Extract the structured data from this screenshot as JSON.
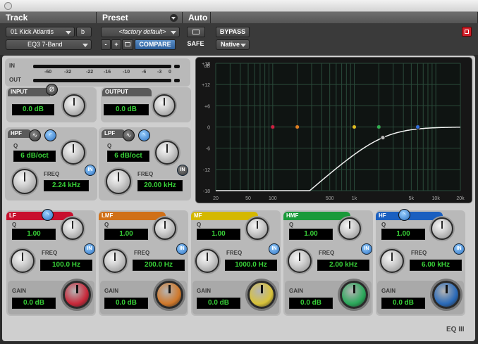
{
  "header": {
    "track_label": "Track",
    "preset_label": "Preset",
    "auto_label": "Auto",
    "track_name": "01 Kick Atlantis",
    "channel_select": "b",
    "insert_plugin": "EQ3 7-Band",
    "preset_name": "<factory default>",
    "minus_label": "-",
    "plus_label": "+",
    "compare_label": "COMPARE",
    "bypass_label": "BYPASS",
    "safe_label": "SAFE",
    "native_label": "Native"
  },
  "meters": {
    "in_label": "IN",
    "out_label": "OUT",
    "scale": [
      "-60",
      "-32",
      "-22",
      "-16",
      "-10",
      "-6",
      "-3",
      "0"
    ]
  },
  "input": {
    "label": "INPUT",
    "value": "0.0 dB"
  },
  "output": {
    "label": "OUTPUT",
    "value": "0.0 dB"
  },
  "hpf": {
    "label": "HPF",
    "q_label": "Q",
    "slope": "6 dB/oct",
    "freq_label": "FREQ",
    "freq": "2.24 kHz",
    "in_label": "IN"
  },
  "lpf": {
    "label": "LPF",
    "q_label": "Q",
    "slope": "6 dB/oct",
    "freq_label": "FREQ",
    "freq": "20.00 kHz",
    "in_label": "IN"
  },
  "graph": {
    "db_label": "dB",
    "y_ticks": [
      "+18",
      "+12",
      "+6",
      "0",
      "-6",
      "-12",
      "-18"
    ],
    "x_ticks": [
      "20",
      "50",
      "100",
      "500",
      "1k",
      "5k",
      "10k",
      "20k"
    ]
  },
  "bands": [
    {
      "name": "LF",
      "q_label": "Q",
      "q": "1.00",
      "freq_label": "FREQ",
      "freq": "100.0 Hz",
      "gain_label": "GAIN",
      "gain": "0.0 dB",
      "in_label": "IN",
      "color": "#c8102e",
      "knob_color": "#c8283a"
    },
    {
      "name": "LMF",
      "q_label": "Q",
      "q": "1.00",
      "freq_label": "FREQ",
      "freq": "200.0 Hz",
      "gain_label": "GAIN",
      "gain": "0.0 dB",
      "in_label": "IN",
      "color": "#d07018",
      "knob_color": "#d0782a"
    },
    {
      "name": "MF",
      "q_label": "Q",
      "q": "1.00",
      "freq_label": "FREQ",
      "freq": "1000.0 Hz",
      "gain_label": "GAIN",
      "gain": "0.0 dB",
      "in_label": "IN",
      "color": "#d4b800",
      "knob_color": "#d8c23a"
    },
    {
      "name": "HMF",
      "q_label": "Q",
      "q": "1.00",
      "freq_label": "FREQ",
      "freq": "2.00 kHz",
      "gain_label": "GAIN",
      "gain": "0.0 dB",
      "in_label": "IN",
      "color": "#1a9a3a",
      "knob_color": "#2aa85a"
    },
    {
      "name": "HF",
      "q_label": "Q",
      "q": "1.00",
      "freq_label": "FREQ",
      "freq": "6.00 kHz",
      "gain_label": "GAIN",
      "gain": "0.0 dB",
      "in_label": "IN",
      "color": "#1a5fc0",
      "knob_color": "#2a6ab8"
    }
  ],
  "footer": {
    "plugin_name": "EQ III"
  }
}
